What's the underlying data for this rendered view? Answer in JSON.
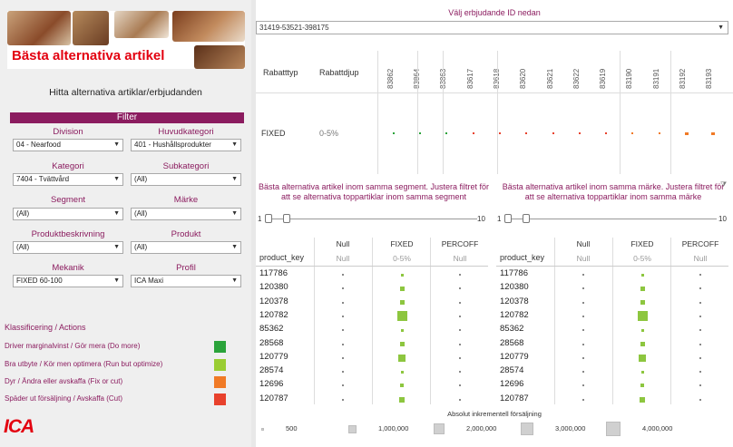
{
  "header": {
    "title": "Bästa alternativa artikel",
    "subtitle": "Hitta alternativa artiklar/erbjudanden"
  },
  "filter": {
    "heading": "Filter",
    "fields": [
      {
        "label": "Division",
        "value": "04 - Nearfood"
      },
      {
        "label": "Huvudkategori",
        "value": "401 - Hushållsprodukter"
      },
      {
        "label": "Kategori",
        "value": "7404 - Tvättvård"
      },
      {
        "label": "Subkategori",
        "value": "(All)"
      },
      {
        "label": "Segment",
        "value": "(All)"
      },
      {
        "label": "Märke",
        "value": "(All)"
      },
      {
        "label": "Produktbeskrivning",
        "value": "(All)"
      },
      {
        "label": "Produkt",
        "value": "(All)"
      },
      {
        "label": "Mekanik",
        "value": "FIXED 60-100"
      },
      {
        "label": "Profil",
        "value": "ICA Maxi"
      }
    ]
  },
  "classification": {
    "heading": "Klassificering / Actions",
    "items": [
      {
        "label": "Driver marginalvinst / Gör mera (Do more)",
        "color": "#2aa33a"
      },
      {
        "label": "Bra utbyte / Kör men optimera (Run but optimize)",
        "color": "#9acd32"
      },
      {
        "label": "Dyr / Ändra eller avskaffa (Fix or cut)",
        "color": "#f07a26"
      },
      {
        "label": "Späder ut försäljning / Avskaffa (Cut)",
        "color": "#e8412c"
      }
    ]
  },
  "logo": "ICA",
  "offer": {
    "label": "Välj erbjudande ID nedan",
    "value": "31419-53521-398175"
  },
  "top_table": {
    "col1": "Rabatttyp",
    "col2": "Rabattdjup",
    "row_type": "FIXED",
    "row_depth": "0-5%",
    "products": [
      "83862",
      "83864",
      "83863",
      "83617",
      "83618",
      "83620",
      "83621",
      "83622",
      "83619",
      "83190",
      "83191",
      "83192",
      "83193"
    ],
    "dot_colors": [
      "#2aa33a",
      "#2aa33a",
      "#2aa33a",
      "#e8412c",
      "#e8412c",
      "#e8412c",
      "#e8412c",
      "#e8412c",
      "#e8412c",
      "#f07a26",
      "#f07a26",
      "#f07a26",
      "#f07a26"
    ]
  },
  "panels": [
    {
      "title": "Bästa alternativa artikel inom samma segment. Justera filtret för att se alternativa toppartiklar inom samma segment",
      "slider_min": "1",
      "slider_max": "10"
    },
    {
      "title": "Bästa alternativa artikel inom samma märke. Justera filtret för att se alternativa toppartiklar inom samma märke",
      "slider_min": "1",
      "slider_max": "10"
    }
  ],
  "matrix": {
    "key_header": "product_key",
    "columns": [
      {
        "name": "Null",
        "sub": "Null"
      },
      {
        "name": "FIXED",
        "sub": "0-5%"
      },
      {
        "name": "PERCOFF",
        "sub": "Null"
      }
    ],
    "rows": [
      "117786",
      "120380",
      "120378",
      "120782",
      "85362",
      "28568",
      "120779",
      "28574",
      "12696",
      "120787"
    ],
    "fixed_sales": [
      250000,
      850000,
      700000,
      4000000,
      350000,
      700000,
      1900000,
      300000,
      600000,
      1200000
    ]
  },
  "size_legend": {
    "title": "Absolut inkrementell försäljning",
    "items": [
      "500",
      "1,000,000",
      "2,000,000",
      "3,000,000",
      "4,000,000"
    ]
  },
  "colors": {
    "accent": "#8b1c5f",
    "ica_red": "#e3000f",
    "mark_green": "#8dc63f"
  }
}
